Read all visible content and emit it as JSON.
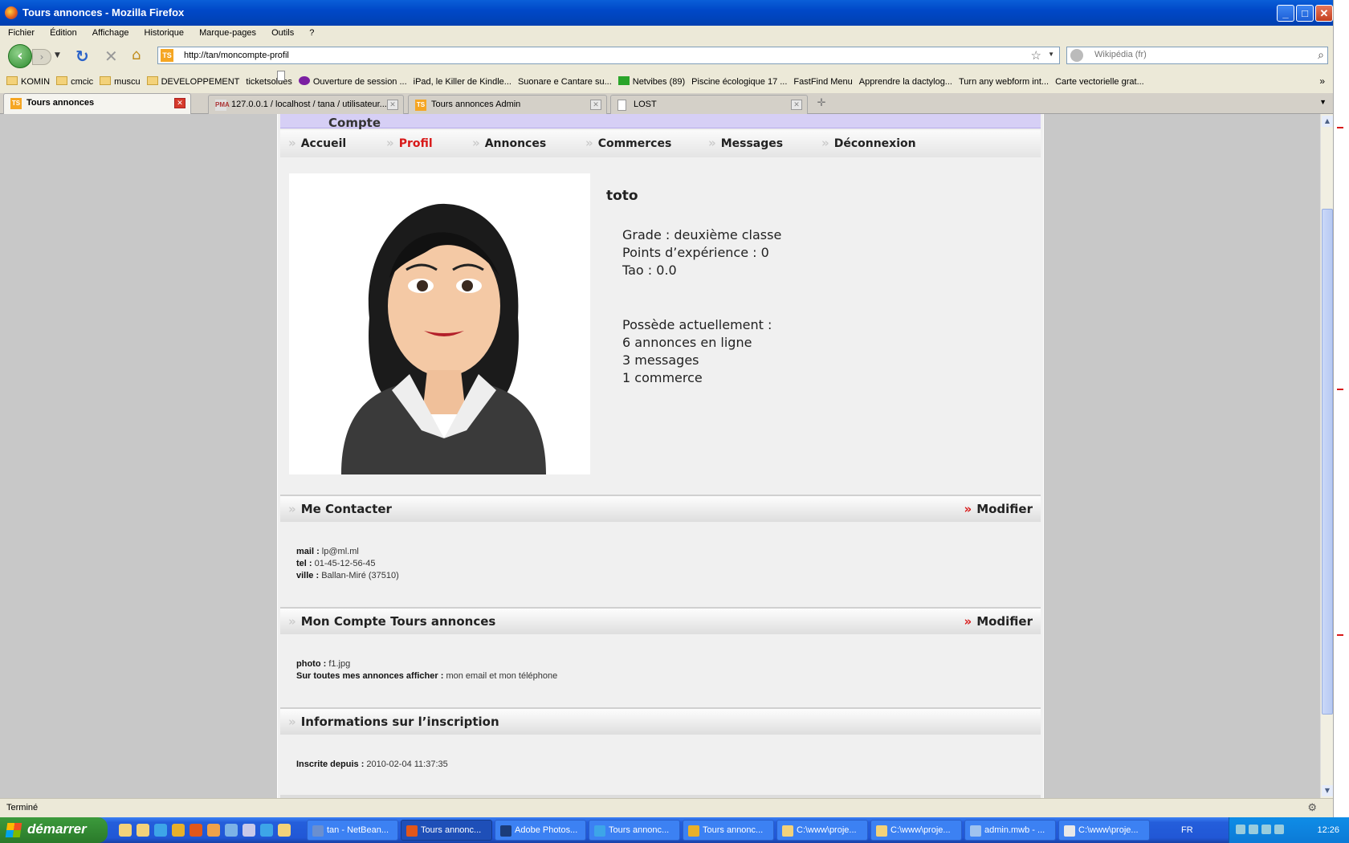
{
  "window": {
    "title": "Tours annonces - Mozilla Firefox",
    "min": "_",
    "max": "□",
    "close": "✕"
  },
  "menubar": [
    "Fichier",
    "Édition",
    "Affichage",
    "Historique",
    "Marque-pages",
    "Outils",
    "?"
  ],
  "nav": {
    "url": "http://tan/moncompte-profil",
    "search_placeholder": "Wikipédia (fr)",
    "site_icon": "TS"
  },
  "bookmarks": [
    {
      "label": "KOMIN",
      "icon": "folder"
    },
    {
      "label": "cmcic",
      "icon": "folder"
    },
    {
      "label": "muscu",
      "icon": "folder"
    },
    {
      "label": "DEVELOPPEMENT",
      "icon": "folder"
    },
    {
      "label": "ticketsoldes",
      "icon": "page"
    },
    {
      "label": "Ouverture de session ...",
      "icon": "yahoo"
    },
    {
      "label": "iPad, le Killer de Kindle...",
      "icon": "page"
    },
    {
      "label": "Suonare e Cantare su...",
      "icon": "page"
    },
    {
      "label": "Netvibes (89)",
      "icon": "plus"
    },
    {
      "label": "Piscine écologique 17 ...",
      "icon": "page"
    },
    {
      "label": "FastFind Menu",
      "icon": "page"
    },
    {
      "label": "Apprendre la dactylog...",
      "icon": "page"
    },
    {
      "label": "Turn any webform int...",
      "icon": "page"
    },
    {
      "label": "Carte vectorielle grat...",
      "icon": "page"
    }
  ],
  "bookmarks_more": "»",
  "tabs": [
    {
      "label": "Tours annonces",
      "icon": "TS",
      "active": true
    },
    {
      "label": "127.0.0.1 / localhost / tana / utilisateur...",
      "icon": "PMA",
      "active": false
    },
    {
      "label": "Tours annonces Admin",
      "icon": "TS",
      "active": false
    },
    {
      "label": "LOST",
      "icon": "",
      "active": false
    }
  ],
  "page": {
    "header_title": "Mon Compte",
    "menu": [
      {
        "label": "Accueil",
        "current": false
      },
      {
        "label": "Profil",
        "current": true
      },
      {
        "label": "Annonces",
        "current": false
      },
      {
        "label": "Commerces",
        "current": false
      },
      {
        "label": "Messages",
        "current": false
      },
      {
        "label": "Déconnexion",
        "current": false
      }
    ],
    "profile": {
      "name": "toto",
      "grade": "Grade : deuxième classe",
      "xp": "Points d’expérience : 0",
      "tao": "Tao : 0.0",
      "owns_title": "Possède actuellement :",
      "ads": "6 annonces en ligne",
      "messages": "3 messages",
      "shops": "1 commerce"
    },
    "contact": {
      "title": "Me Contacter",
      "edit": "Modifier",
      "mail_label": "mail :",
      "mail": "lp@ml.ml",
      "tel_label": "tel :",
      "tel": "01-45-12-56-45",
      "ville_label": "ville :",
      "ville": "Ballan-Miré (37510)"
    },
    "account": {
      "title": "Mon Compte Tours annonces",
      "edit": "Modifier",
      "photo_label": "photo :",
      "photo": "f1.jpg",
      "show_label": "Sur toutes mes annonces afficher :",
      "show": "mon email et mon téléphone"
    },
    "registration": {
      "title": "Informations sur l’inscription",
      "since_label": "Inscrite depuis :",
      "since": "2010-02-04 11:37:35"
    }
  },
  "status": "Terminé",
  "taskbar": {
    "start": "démarrer",
    "tasks": [
      {
        "label": "tan - NetBean...",
        "color": "#6a8fd0"
      },
      {
        "label": "Tours annonc...",
        "color": "#e2571a",
        "active": true
      },
      {
        "label": "Adobe Photos...",
        "color": "#1b3d7a"
      },
      {
        "label": "Tours annonc...",
        "color": "#3da5e8"
      },
      {
        "label": "Tours annonc...",
        "color": "#e8b02a"
      },
      {
        "label": "C:\\www\\proje...",
        "color": "#f3d27a"
      },
      {
        "label": "C:\\www\\proje...",
        "color": "#f3d27a"
      },
      {
        "label": "admin.mwb - ...",
        "color": "#9fc3ef"
      },
      {
        "label": "C:\\www\\proje...",
        "color": "#e8e8e8"
      }
    ],
    "lang": "FR",
    "clock": "12:26"
  }
}
